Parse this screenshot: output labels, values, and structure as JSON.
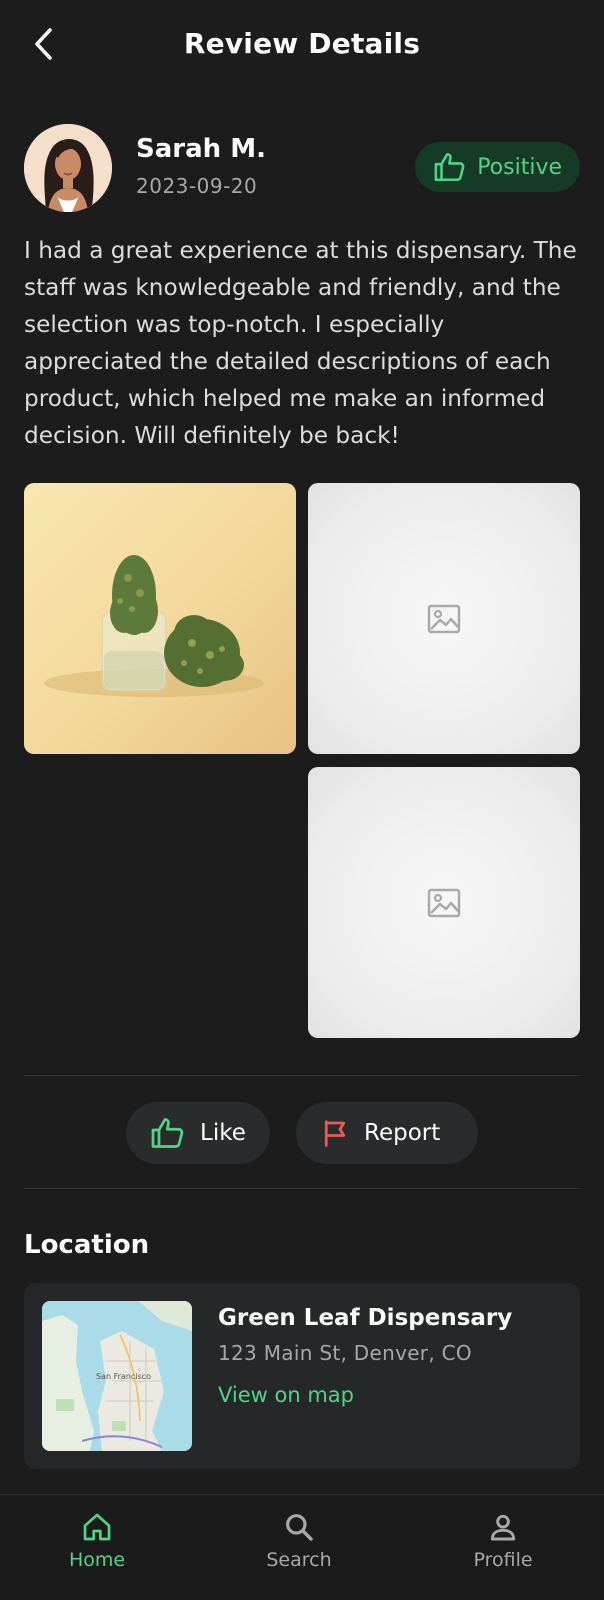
{
  "header": {
    "title": "Review Details",
    "back_icon": "chevron-left-icon"
  },
  "review": {
    "reviewer_name": "Sarah M.",
    "date": "2023-09-20",
    "sentiment": {
      "label": "Positive",
      "icon": "thumbs-up-icon",
      "color": "#4fd586",
      "background": "#153a26"
    },
    "text": "I had a great experience at this dispensary. The staff was knowledgeable and friendly, and the selection was top-notch. I especially appreciated the detailed descriptions of each product, which helped me make an informed decision. Will definitely be back!",
    "photos": [
      {
        "kind": "photo",
        "subject": "cannabis buds in a glass jar"
      },
      {
        "kind": "placeholder",
        "icon": "image-icon"
      },
      {
        "kind": "placeholder",
        "icon": "image-icon"
      }
    ]
  },
  "actions": {
    "like_label": "Like",
    "like_icon": "thumbs-up-icon",
    "report_label": "Report",
    "report_icon": "flag-icon",
    "report_color": "#e85a5a"
  },
  "location": {
    "section_title": "Location",
    "name": "Green Leaf Dispensary",
    "address": "123 Main St, Denver, CO",
    "link_label": "View on map",
    "map_label": "San Francisco"
  },
  "nav": {
    "items": [
      {
        "label": "Home",
        "icon": "home-icon",
        "active": true
      },
      {
        "label": "Search",
        "icon": "search-icon",
        "active": false
      },
      {
        "label": "Profile",
        "icon": "user-icon",
        "active": false
      }
    ]
  },
  "colors": {
    "background": "#1b1c1b",
    "accent": "#4fd586",
    "card": "#262728"
  }
}
